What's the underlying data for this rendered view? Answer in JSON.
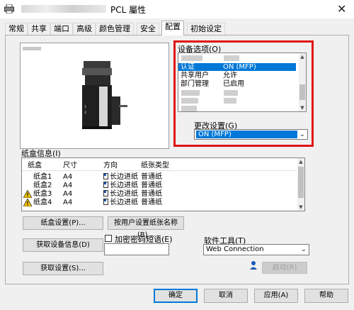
{
  "window": {
    "title": "PCL 屬性",
    "close_glyph": "✕"
  },
  "tabs": [
    "常规",
    "共享",
    "端口",
    "高级",
    "颜色管理",
    "安全",
    "配置",
    "初始设定"
  ],
  "device_options": {
    "label": "设备选项(O)",
    "rows": [
      {
        "name": "认证",
        "value": "ON (MFP)"
      },
      {
        "name": "共享用户",
        "value": "允许"
      },
      {
        "name": "部门管理",
        "value": "已启用"
      }
    ]
  },
  "change_setting": {
    "label": "更改设置(G)",
    "value": "ON (MFP)"
  },
  "tray_info": {
    "label": "纸盒信息(I)",
    "headers": [
      "纸盒",
      "尺寸",
      "方向",
      "纸张类型"
    ],
    "rows": [
      {
        "tray": "纸盒1",
        "size": "A4",
        "orientation": "长边进纸",
        "type": "普通纸",
        "warn": false
      },
      {
        "tray": "纸盒2",
        "size": "A4",
        "orientation": "长边进纸",
        "type": "普通纸",
        "warn": false
      },
      {
        "tray": "纸盒3",
        "size": "A4",
        "orientation": "长边进纸",
        "type": "普通纸",
        "warn": true
      },
      {
        "tray": "纸盒4",
        "size": "A4",
        "orientation": "长边进纸",
        "type": "普通纸",
        "warn": true
      }
    ]
  },
  "buttons": {
    "tray_settings": "纸盒设置(P)...",
    "paper_name": "按用户设置纸张名称(B)...",
    "get_device_info": "获取设备信息(D)",
    "get_settings": "获取设置(S)...",
    "launch": "启动(R)",
    "ok": "确定",
    "cancel": "取消",
    "apply": "应用(A)",
    "help": "帮助"
  },
  "encrypt": {
    "label": "加密密码短语(E)",
    "checked": false
  },
  "software_tool": {
    "label": "软件工具(T)",
    "value": "Web Connection"
  },
  "colors": {
    "highlight_border": "#e01414",
    "selection": "#0078d7"
  }
}
